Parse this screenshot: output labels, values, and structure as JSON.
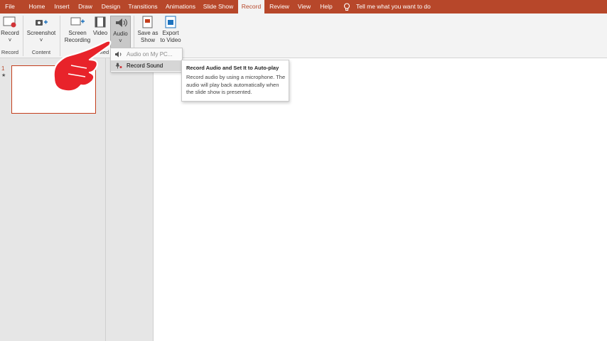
{
  "tabs": [
    {
      "label": "File",
      "active": false
    },
    {
      "label": "Home",
      "active": false
    },
    {
      "label": "Insert",
      "active": false
    },
    {
      "label": "Draw",
      "active": false
    },
    {
      "label": "Design",
      "active": false
    },
    {
      "label": "Transitions",
      "active": false
    },
    {
      "label": "Animations",
      "active": false
    },
    {
      "label": "Slide Show",
      "active": false
    },
    {
      "label": "Record",
      "active": true
    },
    {
      "label": "Review",
      "active": false
    },
    {
      "label": "View",
      "active": false
    },
    {
      "label": "Help",
      "active": false
    }
  ],
  "tellme": {
    "text": "Tell me what you want to do",
    "icon": "lightbulb-icon"
  },
  "ribbon": {
    "record": {
      "label1": "Record",
      "label2": "˅",
      "icon": "record-icon"
    },
    "screenshot": {
      "label1": "Screenshot",
      "label2": "˅",
      "icon": "camera-icon"
    },
    "screen_recording": {
      "label1": "Screen",
      "label2": "Recording",
      "icon": "screen-recording-icon"
    },
    "video": {
      "label1": "Video",
      "label2": "",
      "icon": "film-icon"
    },
    "audio": {
      "label1": "Audio",
      "label2": "˅",
      "icon": "speaker-icon"
    },
    "save_as_show": {
      "label1": "Save as",
      "label2": "Show",
      "icon": "save-show-icon"
    },
    "export_video": {
      "label1": "Export",
      "label2": "to Video",
      "icon": "export-video-icon"
    },
    "groups": {
      "record": "Record",
      "content": "Content",
      "media": "y Med"
    }
  },
  "dropdown": {
    "items": [
      {
        "label": "Audio on My PC...",
        "icon": "speaker-small-icon"
      },
      {
        "label": "Record Sound",
        "icon": "microphone-icon"
      }
    ]
  },
  "tooltip": {
    "title": "Record Audio and Set It to Auto-play",
    "body": "Record audio by using a microphone. The audio will play back automatically when the slide show is presented."
  },
  "slides": [
    {
      "number": "1",
      "marker": "★"
    }
  ],
  "colors": {
    "accent": "#b7472a",
    "thumb_border": "#c43e1c",
    "pointer_hand": "#e8232a"
  }
}
